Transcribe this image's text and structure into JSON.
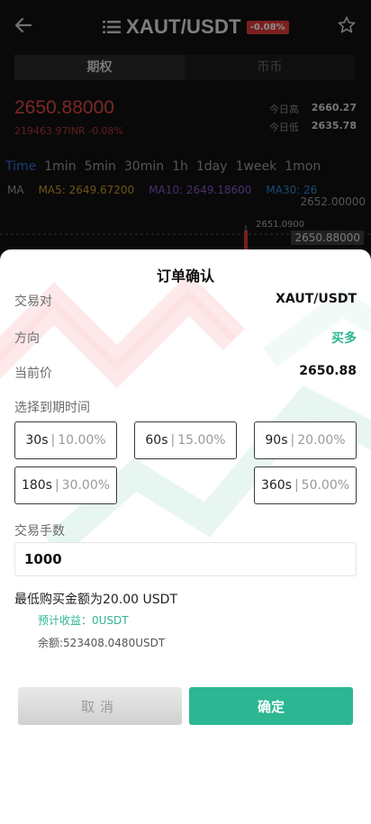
{
  "header": {
    "pair": "XAUT/USDT",
    "change_badge": "-0.08%",
    "icons": {
      "back": "back-arrow-icon",
      "menu": "menu-list-icon",
      "favorite": "star-icon"
    }
  },
  "segment": {
    "tabs": [
      "期权",
      "币币"
    ],
    "active": 0
  },
  "ticker": {
    "price": "2650.88000",
    "sub": "219463.97INR  -0.08%",
    "high_label": "今日高",
    "high_value": "2660.27",
    "low_label": "今日低",
    "low_value": "2635.78"
  },
  "timeframes": [
    "Time",
    "1min",
    "5min",
    "30min",
    "1h",
    "1day",
    "1week",
    "1mon"
  ],
  "ma": {
    "label": "MA",
    "ma5": "MA5: 2649.67200",
    "ma10": "MA10: 2649.18600",
    "ma30": "MA30: 26"
  },
  "chart": {
    "axis_top": "2652.00000",
    "marker_label": "2651.0900",
    "current_tag": "2650.88000"
  },
  "modal": {
    "title": "订单确认",
    "pair_label": "交易对",
    "pair_value": "XAUT/USDT",
    "direction_label": "方向",
    "direction_value": "买多",
    "current_price_label": "当前价",
    "current_price_value": "2650.88",
    "expiry_label": "选择到期时间",
    "options": [
      {
        "sec": "30s",
        "pct": "10.00%"
      },
      {
        "sec": "60s",
        "pct": "15.00%"
      },
      {
        "sec": "90s",
        "pct": "20.00%"
      },
      {
        "sec": "180s",
        "pct": "30.00%"
      },
      {
        "sec": "360s",
        "pct": "50.00%"
      }
    ],
    "amount_label": "交易手数",
    "amount_value": "1000",
    "min_purchase": "最低购买金额为20.00 USDT",
    "expected_income": "预计收益：0USDT",
    "balance": "余额:523408.0480USDT",
    "cancel_label": "取消",
    "confirm_label": "确定"
  },
  "colors": {
    "accent_green": "#2db692",
    "down_red": "#e24848",
    "active_blue": "#2f6fd6"
  }
}
